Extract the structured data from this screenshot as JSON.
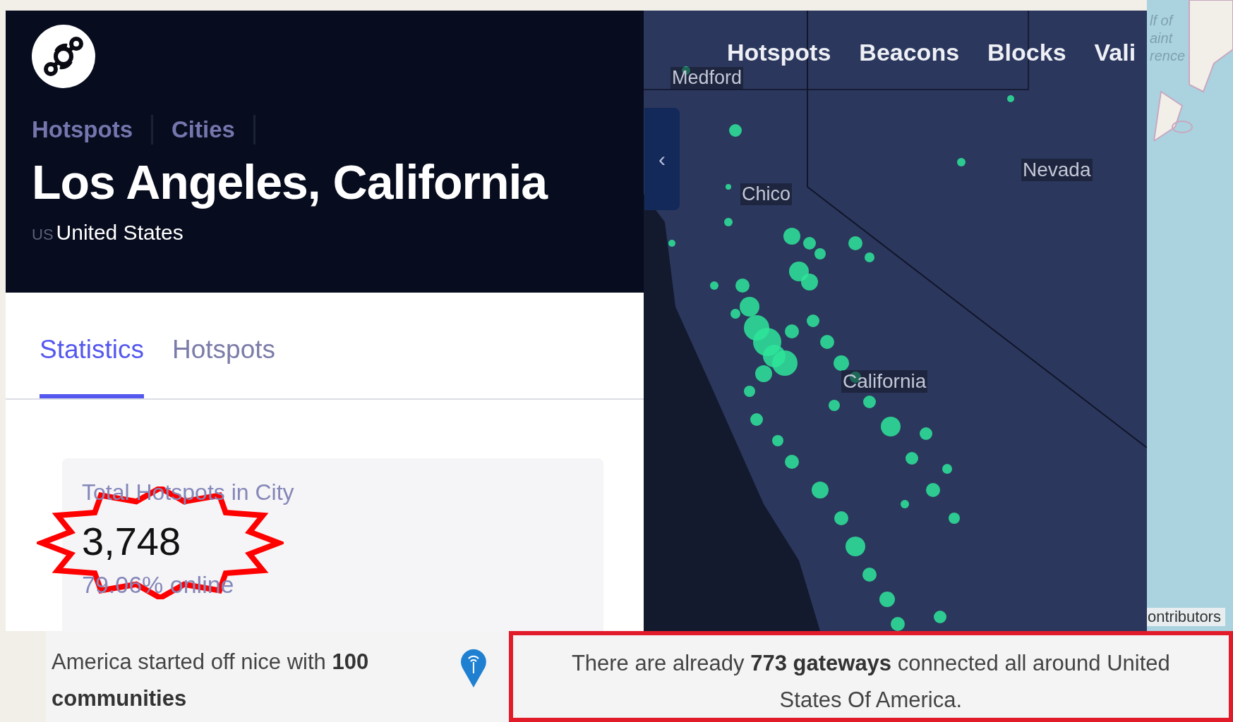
{
  "header": {
    "breadcrumbs": [
      "Hotspots",
      "Cities"
    ],
    "title": "Los Angeles, California",
    "country_code": "US",
    "country": "United States"
  },
  "tabs": [
    {
      "label": "Statistics",
      "selected": true
    },
    {
      "label": "Hotspots",
      "selected": false
    }
  ],
  "stat_card": {
    "label": "Total Hotspots in City",
    "value": "3,748",
    "online": "79.06% online",
    "circled": true
  },
  "map": {
    "nav": [
      "Hotspots",
      "Beacons",
      "Blocks",
      "Vali"
    ],
    "collapse_glyph": "‹",
    "labels": [
      {
        "text": "Medford",
        "kind": "city"
      },
      {
        "text": "Chico",
        "kind": "city"
      },
      {
        "text": "Nevada",
        "kind": "state"
      },
      {
        "text": "California",
        "kind": "state"
      }
    ],
    "outer_labels": [
      "lf of",
      "aint",
      "rence"
    ],
    "attribution": "ontributors"
  },
  "captions": [
    {
      "text": "America started off nice with **100 communities**",
      "highlighted": false
    },
    {
      "text": "There are already **773 gateways** connected all around United States Of America.",
      "highlighted": true
    }
  ]
}
